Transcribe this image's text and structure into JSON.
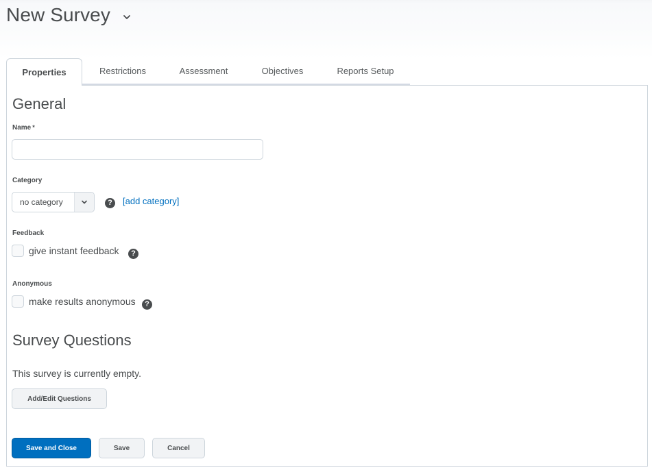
{
  "header": {
    "title": "New Survey",
    "title_menu_icon": "chevron-down-icon"
  },
  "tabs": [
    {
      "label": "Properties",
      "active": true
    },
    {
      "label": "Restrictions",
      "active": false
    },
    {
      "label": "Assessment",
      "active": false
    },
    {
      "label": "Objectives",
      "active": false
    },
    {
      "label": "Reports Setup",
      "active": false
    }
  ],
  "general": {
    "heading": "General",
    "name": {
      "label": "Name",
      "required_marker": "*",
      "value": "",
      "placeholder": ""
    },
    "category": {
      "label": "Category",
      "selected": "no category",
      "help_icon": "help-icon",
      "add_link": "[add category]"
    },
    "feedback": {
      "label": "Feedback",
      "checkbox_label": "give instant feedback",
      "checked": false,
      "help_icon": "help-icon"
    },
    "anonymous": {
      "label": "Anonymous",
      "checkbox_label": "make results anonymous",
      "checked": false,
      "help_icon": "help-icon"
    }
  },
  "questions": {
    "heading": "Survey Questions",
    "empty_text": "This survey is currently empty.",
    "add_edit_button": "Add/Edit Questions"
  },
  "footer": {
    "save_close_button": "Save and Close",
    "save_button": "Save",
    "cancel_button": "Cancel"
  },
  "colors": {
    "primary": "#006fbf",
    "link": "#006fbf",
    "text": "#494c4e",
    "border": "#cdd5dc"
  }
}
